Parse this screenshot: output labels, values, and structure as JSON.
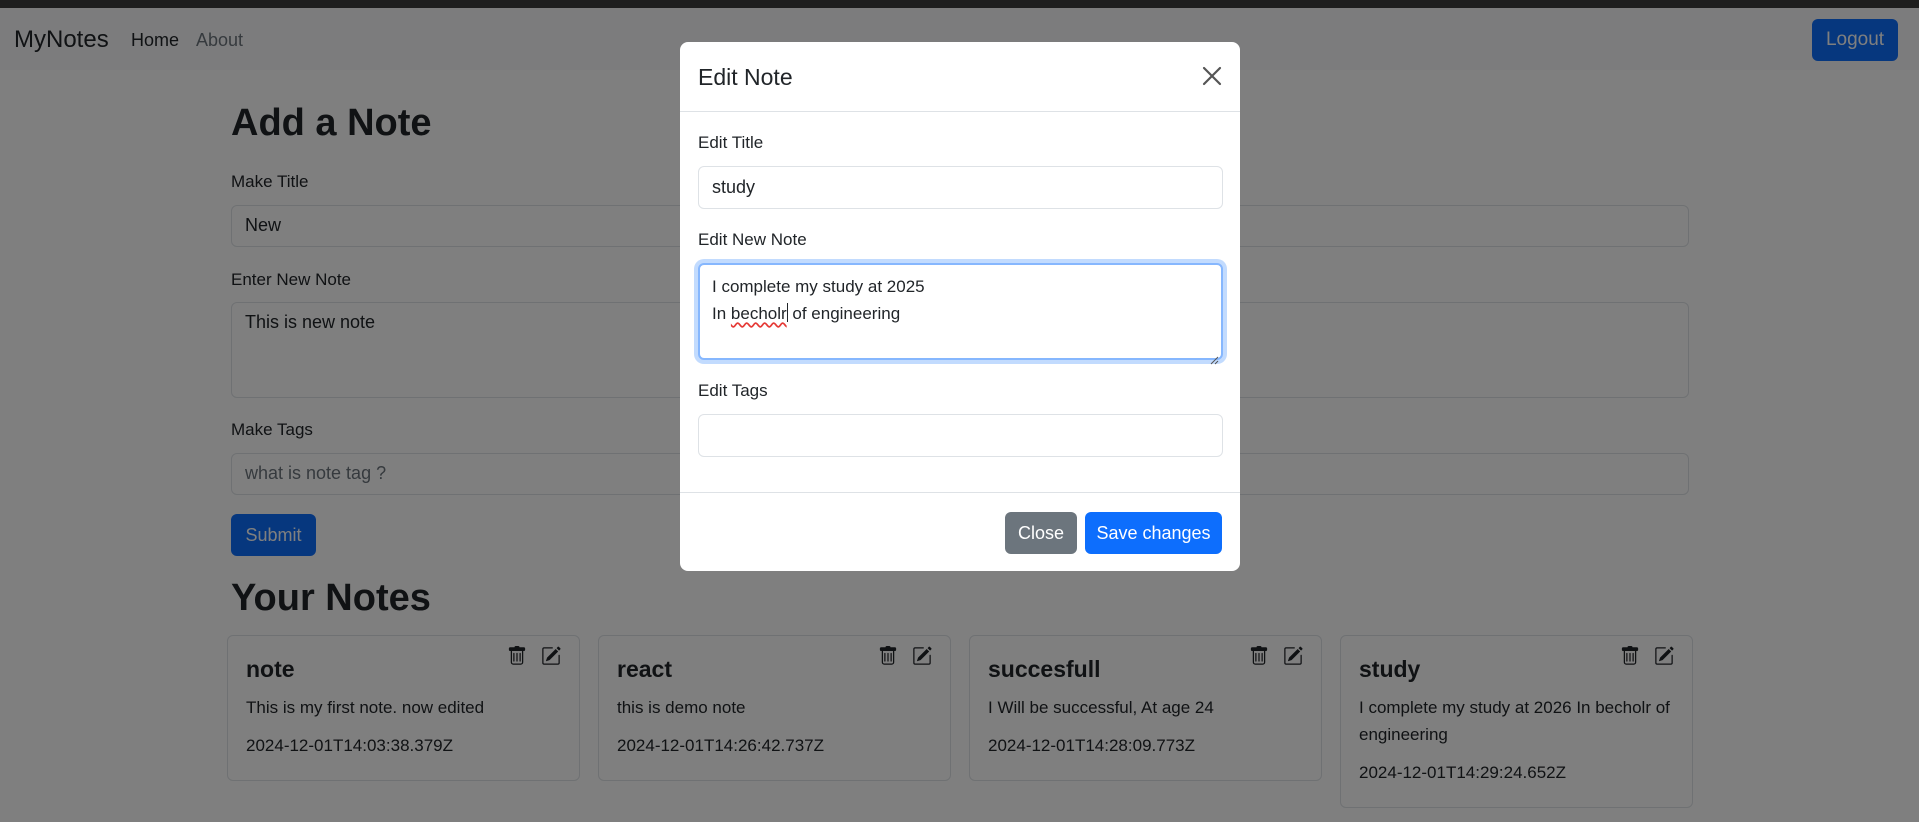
{
  "navbar": {
    "brand": "MyNotes",
    "links": [
      {
        "label": "Home"
      },
      {
        "label": "About"
      }
    ],
    "logout_label": "Logout"
  },
  "add_note": {
    "heading": "Add a Note",
    "title_label": "Make Title",
    "title_value": "New",
    "note_label": "Enter New Note",
    "note_value": "This is new note",
    "tags_label": "Make Tags",
    "tags_placeholder": "what is note tag ?",
    "submit_label": "Submit"
  },
  "notes": {
    "heading": "Your Notes",
    "items": [
      {
        "title": "note",
        "description": "This is my first note. now edited",
        "date": "2024-12-01T14:03:38.379Z"
      },
      {
        "title": "react",
        "description": "this is demo note",
        "date": "2024-12-01T14:26:42.737Z"
      },
      {
        "title": "succesfull",
        "description": "I Will be successful, At age 24",
        "date": "2024-12-01T14:28:09.773Z"
      },
      {
        "title": "study",
        "description": "I complete my study at 2026 In becholr of engineering",
        "date": "2024-12-01T14:29:24.652Z"
      }
    ]
  },
  "modal": {
    "title": "Edit Note",
    "title_label": "Edit Title",
    "title_value": "study",
    "note_label": "Edit New Note",
    "note_line1": "I complete my study at 2025",
    "note_line2_pre": "In ",
    "note_line2_misspelled": "becholr",
    "note_line2_post": " of engineering",
    "tags_label": "Edit Tags",
    "tags_value": "",
    "close_label": "Close",
    "save_label": "Save changes"
  },
  "colors": {
    "primary": "#0d6efd",
    "secondary": "#6c757d",
    "focus_border": "#86b7fe"
  },
  "icons": [
    "trash-icon",
    "edit-icon",
    "close-icon"
  ]
}
